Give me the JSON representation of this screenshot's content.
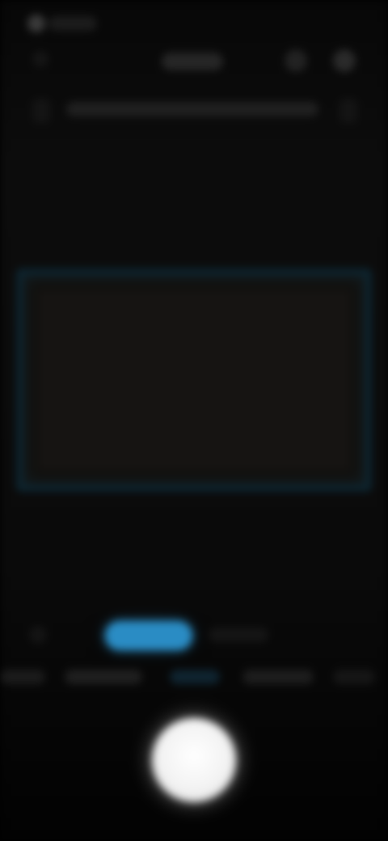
{
  "app": {
    "title": "",
    "view": "camera-capture"
  },
  "status_bar": {
    "text": ""
  },
  "toolbar": {
    "center_label": "",
    "left_icon": "chevron-left-icon",
    "icons": [
      "flash-icon",
      "settings-icon"
    ]
  },
  "hint_bar": {
    "text": ""
  },
  "modes": {
    "active_label": "",
    "next_label": "",
    "row2_labels": [
      "",
      "",
      "",
      "",
      ""
    ]
  },
  "colors": {
    "accent": "#2a8cc4",
    "viewfinder_border": "#0d2530",
    "background": "#000000",
    "shutter": "#ffffff"
  }
}
